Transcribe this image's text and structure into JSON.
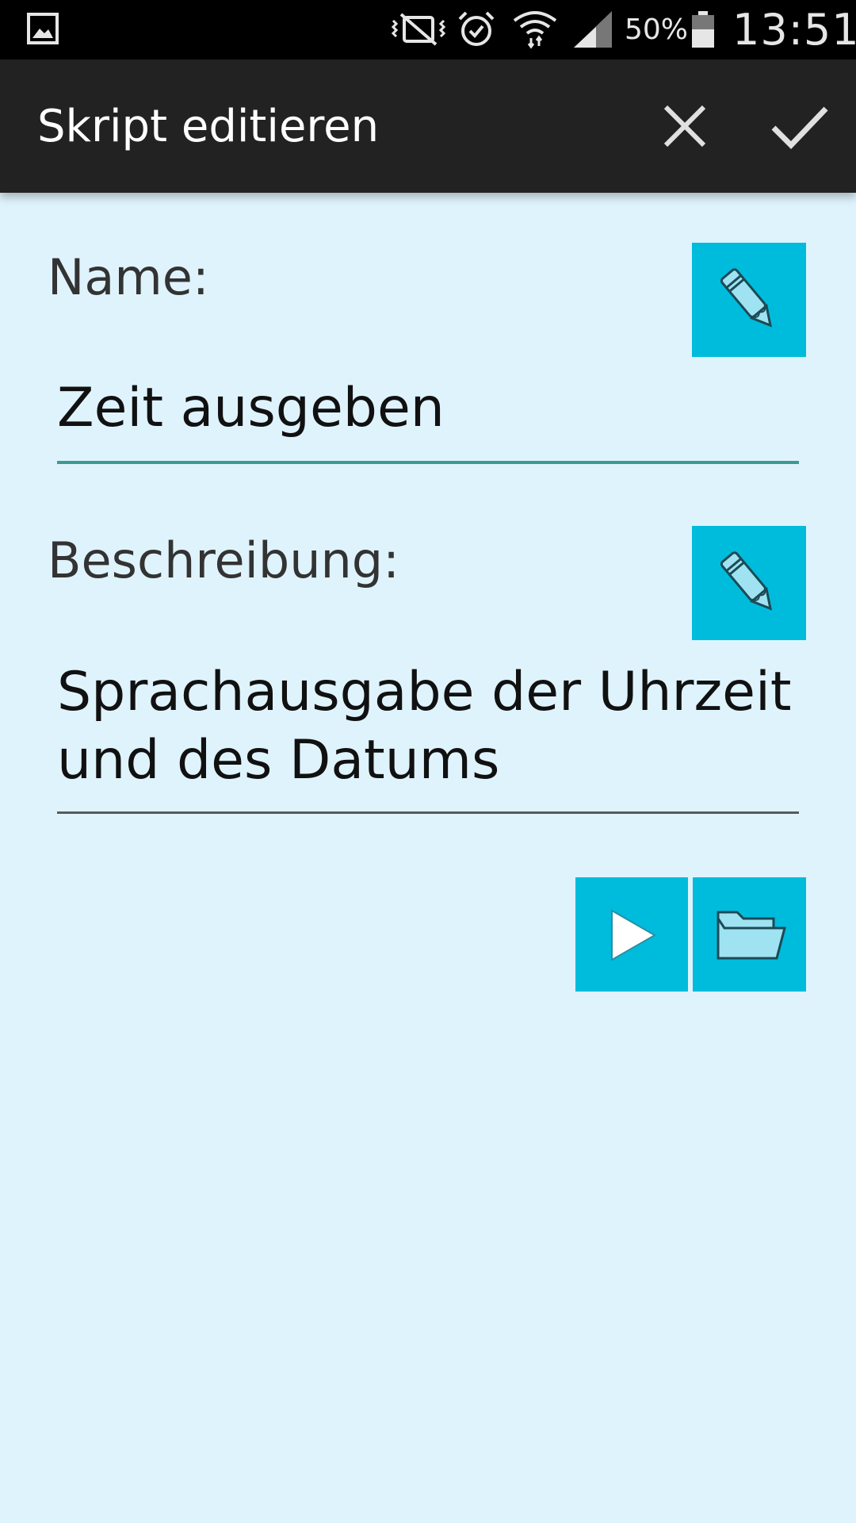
{
  "status_bar": {
    "icons": [
      "gallery-notification-icon",
      "mute-vibrate-icon",
      "alarm-icon",
      "wifi-icon",
      "signal-icon",
      "battery-icon"
    ],
    "battery_percent": "50%",
    "time": "13:51"
  },
  "action_bar": {
    "title": "Skript editieren",
    "cancel_icon": "close-icon",
    "confirm_icon": "check-icon"
  },
  "form": {
    "name_label": "Name:",
    "name_value": "Zeit ausgeben",
    "description_label": "Beschreibung:",
    "description_value_line1": "Sprachausgabe der Uhrzeit",
    "description_value_line2": "und des Datums",
    "edit_icon": "pencil-icon"
  },
  "tools": {
    "play_icon": "play-icon",
    "folder_icon": "folder-icon"
  },
  "colors": {
    "background": "#dff3fd",
    "action_bar": "#222222",
    "accent_button": "#00bcdc",
    "active_underline": "#3a9a93"
  }
}
